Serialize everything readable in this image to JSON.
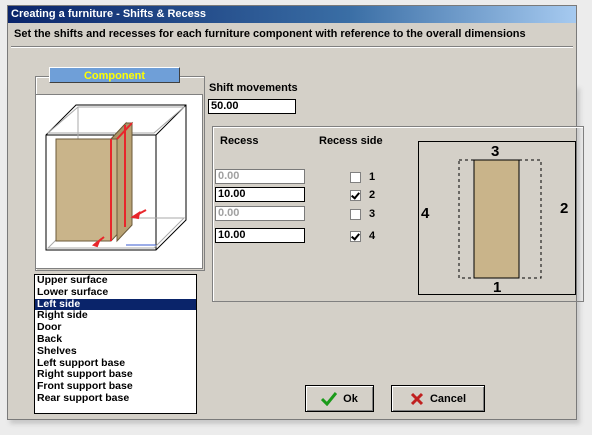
{
  "window": {
    "title": "Creating a furniture - Shifts & Recess"
  },
  "instruction": "Set the shifts and recesses for each furniture component with reference to the overall dimensions",
  "component": {
    "tab_label": "Component",
    "list": [
      "Upper surface",
      "Lower surface",
      "Left side",
      "Right side",
      "Door",
      "Back",
      "Shelves",
      "Left support base",
      "Right support base",
      "Front support base",
      "Rear support base"
    ],
    "selected": "Left side"
  },
  "shift": {
    "label": "Shift movements",
    "value": "50.00"
  },
  "recess": {
    "header": "Recess",
    "side_header": "Recess side",
    "rows": [
      {
        "value": "0.00",
        "side": "1",
        "checked": false,
        "enabled": false
      },
      {
        "value": "10.00",
        "side": "2",
        "checked": true,
        "enabled": true
      },
      {
        "value": "0.00",
        "side": "3",
        "checked": false,
        "enabled": false
      },
      {
        "value": "10.00",
        "side": "4",
        "checked": true,
        "enabled": true
      }
    ]
  },
  "diagram": {
    "top": "3",
    "right": "2",
    "bottom": "1",
    "left": "4"
  },
  "buttons": {
    "ok": "Ok",
    "cancel": "Cancel"
  },
  "colors": {
    "panel": "#c9b48a",
    "selection": "#0a246a",
    "highlight": "#e8262b",
    "tab": "#6f9fd8",
    "tab_text": "#ffff00"
  },
  "icons": {
    "ok": "check-icon",
    "cancel": "x-icon"
  }
}
